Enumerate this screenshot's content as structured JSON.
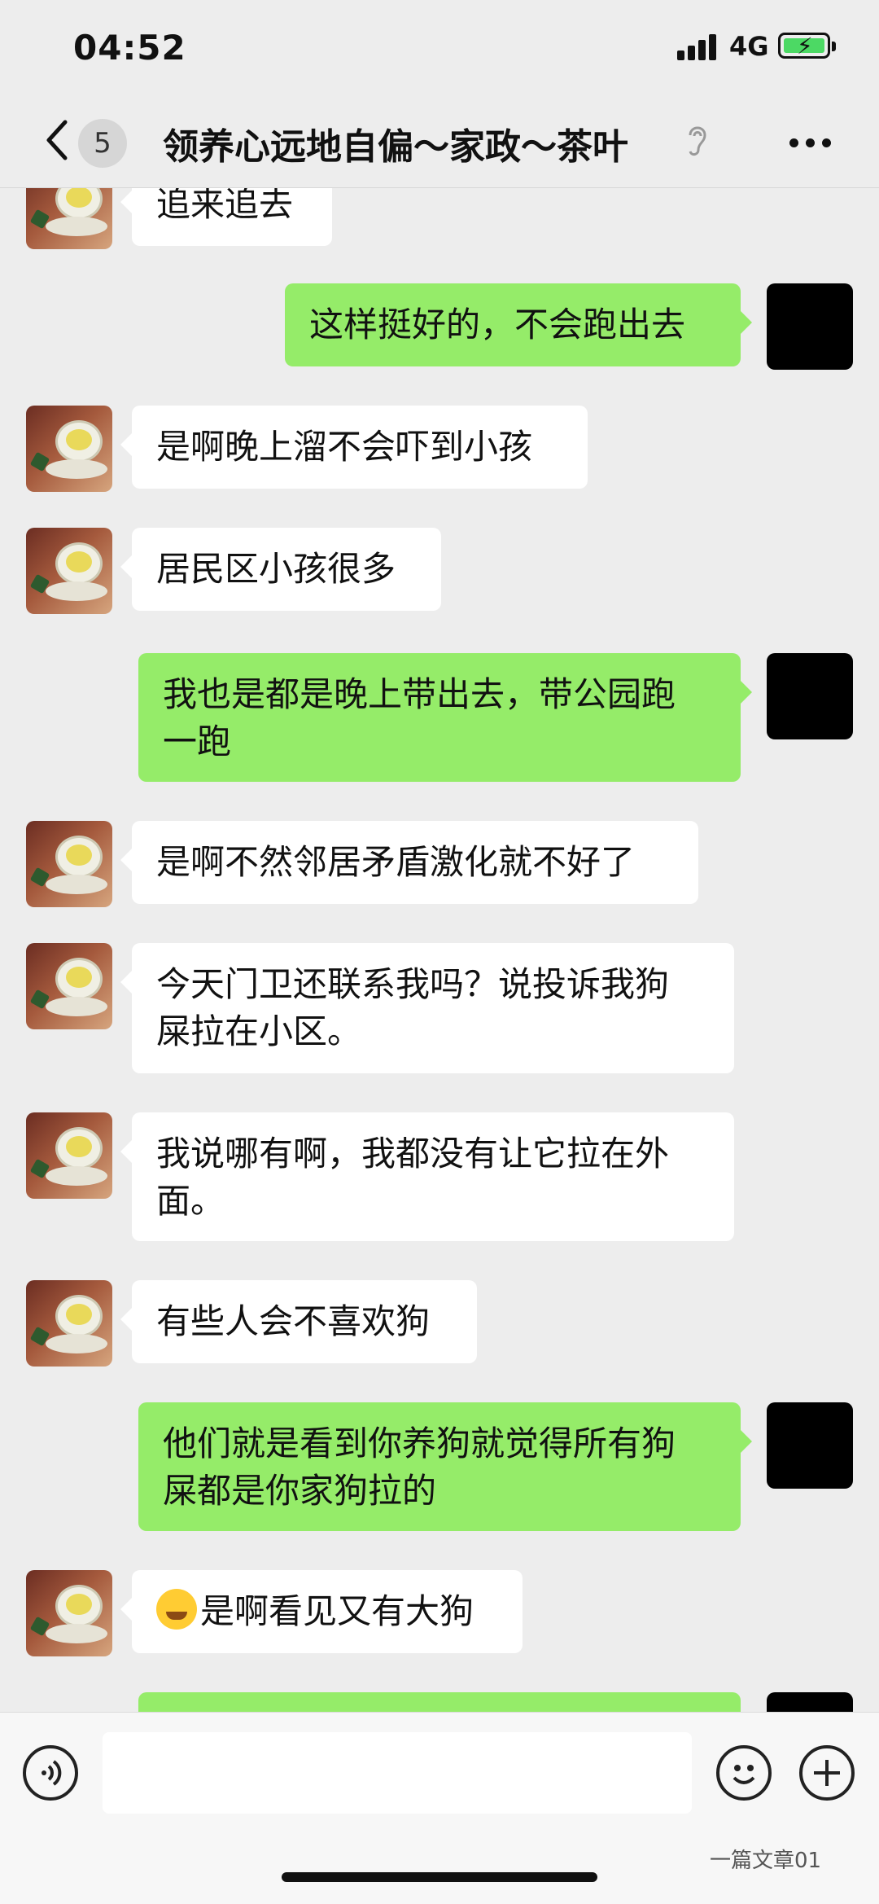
{
  "status_bar": {
    "time": "04:52",
    "network": "4G"
  },
  "header": {
    "unread_count": "5",
    "title": "领养心远地自偏～家政～茶叶"
  },
  "messages": [
    {
      "side": "left",
      "text": "追来追去"
    },
    {
      "side": "right",
      "text": "这样挺好的，不会跑出去"
    },
    {
      "side": "left",
      "text": "是啊晚上溜不会吓到小孩"
    },
    {
      "side": "left",
      "text": "居民区小孩很多"
    },
    {
      "side": "right",
      "line1": "我也是都是晚上带出去，带公园跑",
      "line2": "一跑"
    },
    {
      "side": "left",
      "text": "是啊不然邻居矛盾激化就不好了"
    },
    {
      "side": "left",
      "line1": "今天门卫还联系我吗？说投诉我狗",
      "line2": "屎拉在小区。"
    },
    {
      "side": "left",
      "line1": "我说哪有啊，我都没有让它拉在外",
      "line2": "面。"
    },
    {
      "side": "left",
      "text": "有些人会不喜欢狗"
    },
    {
      "side": "right",
      "line1": "他们就是看到你养狗就觉得所有狗",
      "line2": "屎都是你家狗拉的"
    },
    {
      "side": "left",
      "emoji": "facepalm-emoji",
      "text": "是啊看见又有大狗"
    },
    {
      "side": "right",
      "text": ""
    }
  ],
  "watermark": "一篇文章01"
}
